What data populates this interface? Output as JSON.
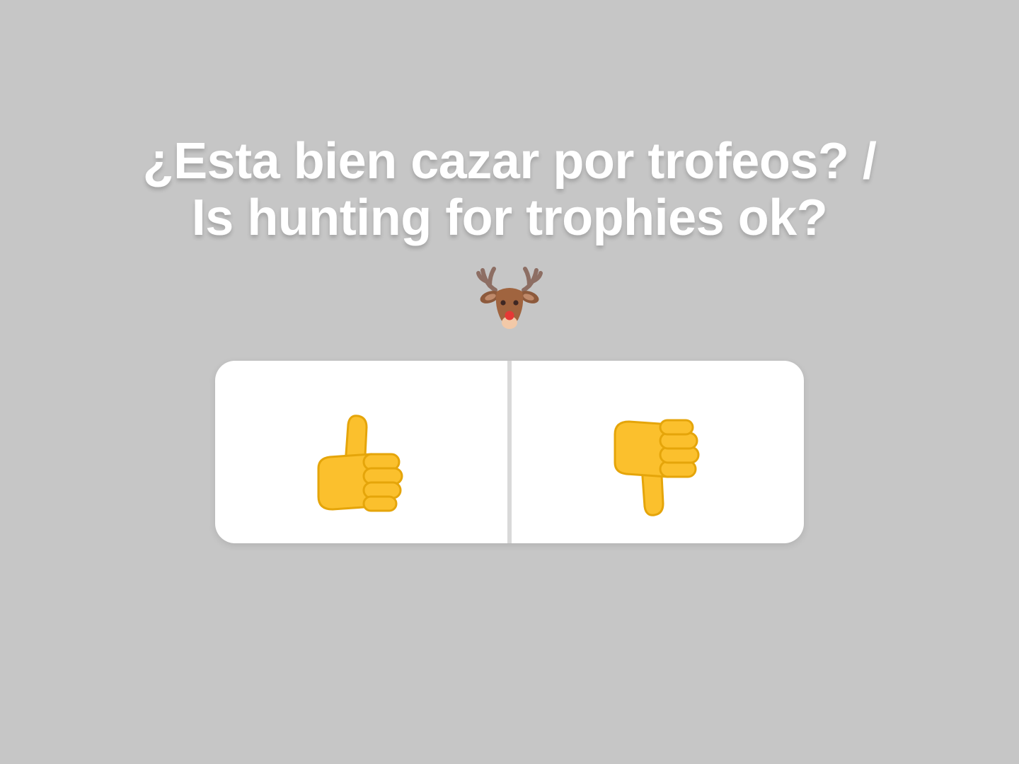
{
  "question": {
    "line1": "¿Esta bien cazar por trofeos? /",
    "line2": "Is hunting for trophies ok?",
    "emoji_icon": "deer-face-icon"
  },
  "poll": {
    "options": [
      {
        "icon": "thumbs-up-icon"
      },
      {
        "icon": "thumbs-down-icon"
      }
    ]
  },
  "colors": {
    "background": "#c6c6c6",
    "card": "#ffffff",
    "divider": "#d9d9d9",
    "text": "#ffffff",
    "thumb_fill": "#fbc02d",
    "thumb_shade": "#e5a50a"
  }
}
